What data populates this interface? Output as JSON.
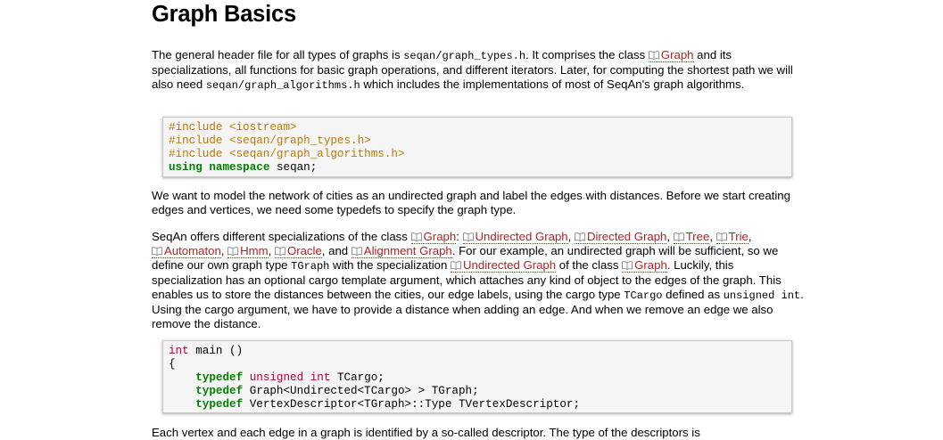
{
  "title": "Graph Basics",
  "p1": {
    "t1": "The general header file for all types of graphs is ",
    "c1": "seqan/graph_types.h",
    "t2": ". It comprises the class ",
    "l1": "Graph",
    "t3": " and its specializations, all functions for basic graph operations, and different iterators. Later, for computing the shortest path we will also need ",
    "c2": "seqan/graph_algorithms.h",
    "t4": " which includes the implementations of most of SeqAn's graph algorithms."
  },
  "code1": {
    "line1": "#include <iostream>",
    "line2": "#include <seqan/graph_types.h>",
    "line3": "#include <seqan/graph_algorithms.h>",
    "line4_kw1": "using",
    "line4_kw2": "namespace",
    "line4_rest": " seqan;"
  },
  "p2": "We want to model the network of cities as an undirected graph and label the edges with distances. Before we start creating edges and vertices, we need some typedefs to specify the graph type.",
  "p3": {
    "t1": "SeqAn offers different specializations of the class ",
    "l_graph": "Graph",
    "t2": ": ",
    "l_undirected": "Undirected Graph",
    "sep1": ", ",
    "l_directed": "Directed Graph",
    "sep2": ", ",
    "l_tree": "Tree",
    "sep3": ", ",
    "l_trie": "Trie",
    "sep4": ", ",
    "l_automaton": "Automaton",
    "sep5": ", ",
    "l_hmm": "Hmm",
    "sep6": ", ",
    "l_oracle": "Oracle",
    "sep7": ", and ",
    "l_alignment": "Alignment Graph",
    "t3": ". For our example, an undirected graph will be sufficient, so we define our own graph type ",
    "c_tgraph": "TGraph",
    "t4": " with the specialization ",
    "l_undirected2": "Undirected Graph",
    "t5": " of the class ",
    "l_graph2": "Graph",
    "t6": ". Luckily, this specialization has an optional cargo template argument, which attaches any kind of object to the edges of the graph. This enables us to store the distances between the cities, our edge labels, using the cargo type ",
    "c_tcargo": "TCargo",
    "t7": " defined as ",
    "c_unsigned": "unsigned int",
    "t8": ". Using the cargo argument, we have to provide a distance when adding an edge. And when we remove an edge we also remove the distance."
  },
  "code2": {
    "line1_ty": "int",
    "line1_rest": " main ()",
    "line2": "{",
    "line3_kw": "typedef",
    "line3_ty": "unsigned int",
    "line3_rest": " TCargo;",
    "line4_kw": "typedef",
    "line4_rest": " Graph<Undirected<TCargo> > TGraph;",
    "line5_kw": "typedef",
    "line5_rest": " VertexDescriptor<TGraph>::Type TVertexDescriptor;"
  },
  "p4": "Each vertex and each edge in a graph is identified by a so-called descriptor. The type of the descriptors is"
}
